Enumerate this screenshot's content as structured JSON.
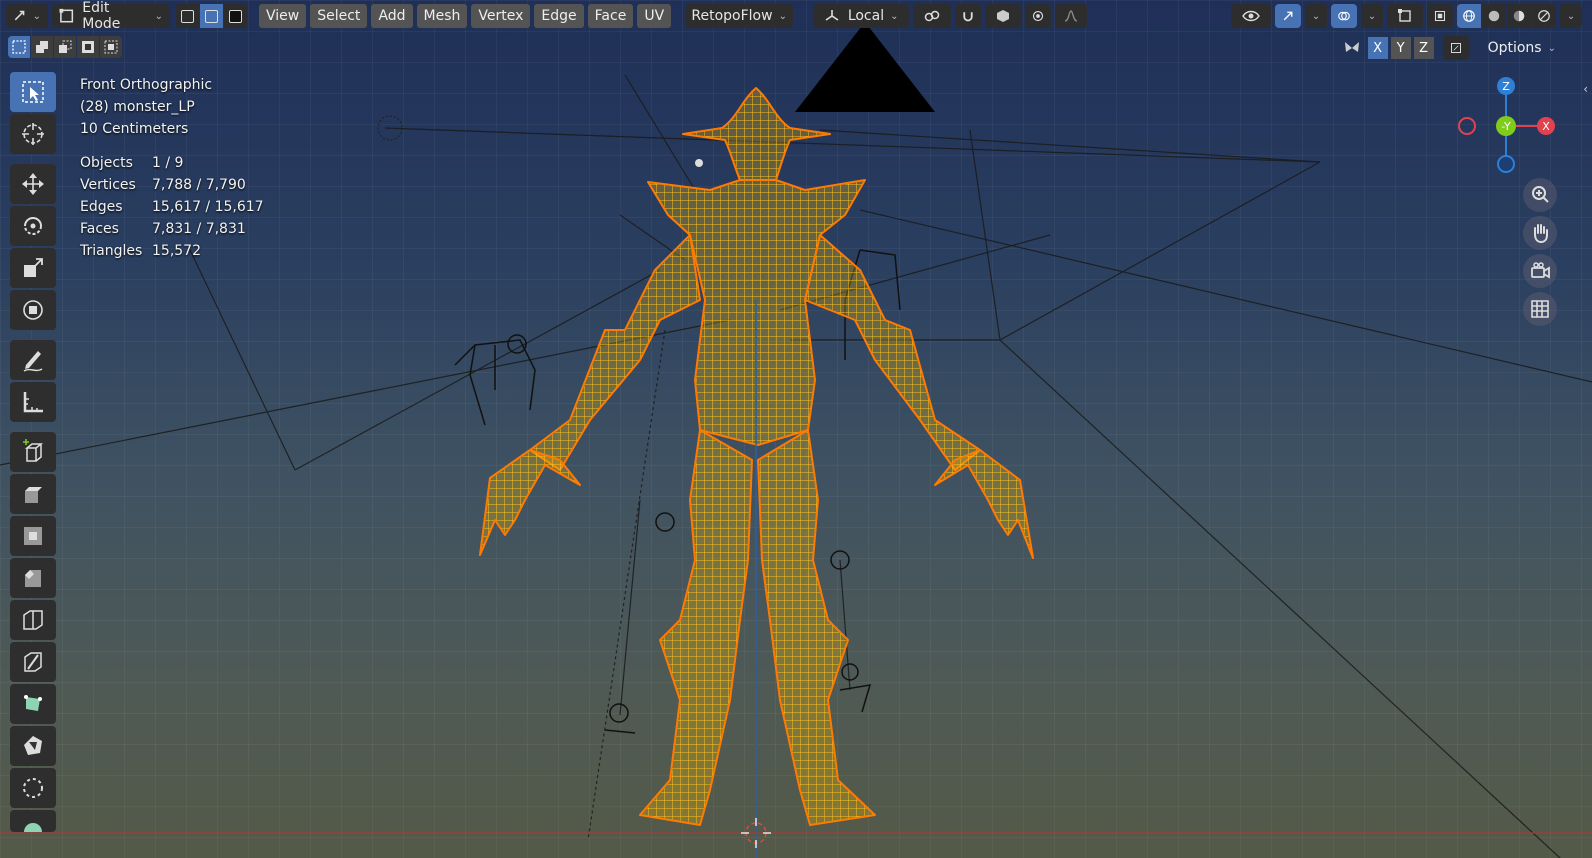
{
  "header": {
    "mode_label": "Edit Mode",
    "menus": [
      "View",
      "Select",
      "Add",
      "Mesh",
      "Vertex",
      "Edge",
      "Face",
      "UV"
    ],
    "addon_label": "RetopoFlow",
    "orientation_label": "Local",
    "options_label": "Options",
    "axis_labels": [
      "X",
      "Y",
      "Z"
    ]
  },
  "viewport": {
    "view_name": "Front Orthographic",
    "object_name": "(28) monster_LP",
    "scale_label": "10 Centimeters"
  },
  "stats": [
    {
      "label": "Objects",
      "value": "1 / 9"
    },
    {
      "label": "Vertices",
      "value": "7,788 / 7,790"
    },
    {
      "label": "Edges",
      "value": "15,617 / 15,617"
    },
    {
      "label": "Faces",
      "value": "7,831 / 7,831"
    },
    {
      "label": "Triangles",
      "value": "15,572"
    }
  ],
  "gizmo": {
    "z": "Z",
    "y": "-Y",
    "x": "X"
  },
  "tools": [
    "select-box-icon",
    "cursor-icon",
    "move-icon",
    "rotate-icon",
    "scale-icon",
    "transform-icon",
    "annotate-icon",
    "measure-icon",
    "add-cube-icon",
    "extrude-icon",
    "inset-icon",
    "bevel-icon",
    "loop-cut-icon",
    "knife-icon",
    "poly-build-icon",
    "spin-icon",
    "smooth-icon",
    "shrink-icon"
  ],
  "colors": {
    "accent": "#4772b3",
    "wire": "#ffb600",
    "wire_edge": "#ff6a00",
    "axis_x": "#e0424f",
    "axis_y": "#7fcc1a",
    "axis_z": "#2e7fd6"
  }
}
